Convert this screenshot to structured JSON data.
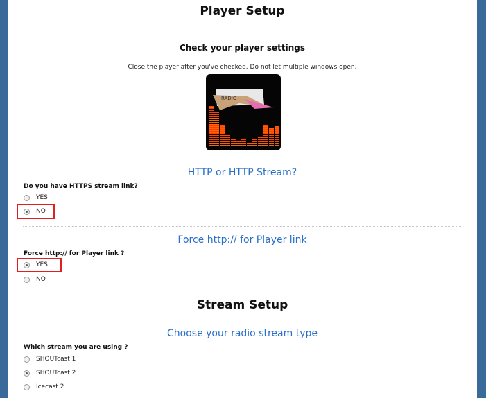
{
  "page": {
    "title": "Player Setup"
  },
  "player_check": {
    "heading": "Check your player settings",
    "note": "Close the player after you've checked. Do not let multiple windows open.",
    "logo_text": "RADIO",
    "eq_levels": [
      0.58,
      0.49,
      0.31,
      0.17,
      0.12,
      0.09,
      0.11,
      0.06,
      0.12,
      0.13,
      0.31,
      0.26,
      0.3
    ]
  },
  "https_section": {
    "title": "HTTP or HTTP Stream?",
    "question": "Do you have HTTPS stream link?",
    "options": [
      {
        "label": "YES",
        "checked": false
      },
      {
        "label": "NO",
        "checked": true
      }
    ]
  },
  "force_section": {
    "title": "Force http:// for Player link",
    "question": "Force http:// for Player link ?",
    "options": [
      {
        "label": "YES",
        "checked": true
      },
      {
        "label": "NO",
        "checked": false
      }
    ]
  },
  "stream_setup": {
    "heading": "Stream Setup",
    "title": "Choose your radio stream type",
    "question": "Which stream you are using ?",
    "options": [
      {
        "label": "SHOUTcast 1",
        "checked": false
      },
      {
        "label": "SHOUTcast 2",
        "checked": true
      },
      {
        "label": "Icecast 2",
        "checked": false
      }
    ]
  },
  "colors": {
    "frame": "#3a6a9a",
    "section_title": "#2a6fc9",
    "highlight": "#e02020"
  }
}
